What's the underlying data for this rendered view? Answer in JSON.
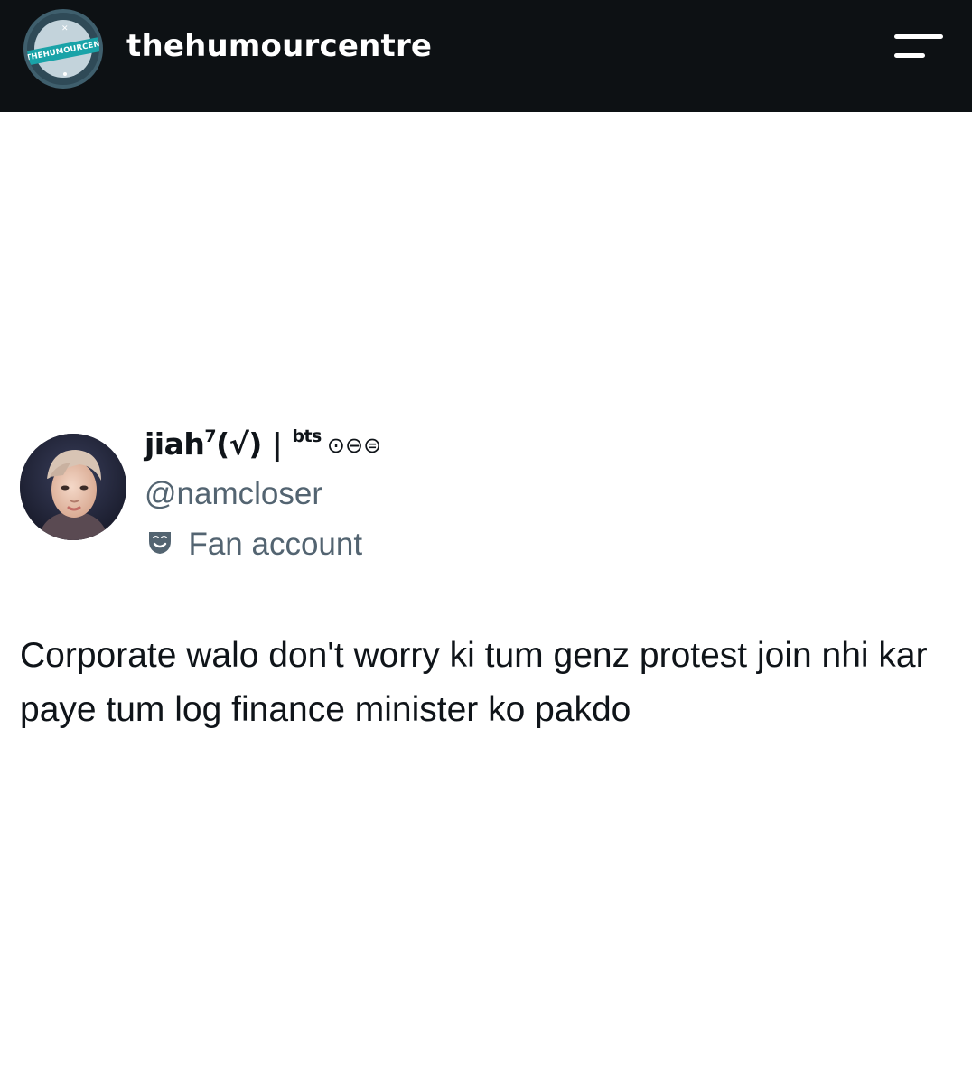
{
  "header": {
    "account_name": "thehumourcentre",
    "logo_text": "THEHUMOURCENTRE",
    "logo_icon": "humour-centre-logo-icon",
    "menu_icon": "hamburger-menu-icon"
  },
  "tweet": {
    "display_name": "jiah",
    "display_name_sup": "7",
    "display_name_rest": "(√) | ",
    "display_name_bts": "bts",
    "display_name_emojis": "⊙⊖⊜",
    "handle": "@namcloser",
    "badge_icon": "theater-mask-icon",
    "badge_label": "Fan account",
    "avatar_icon": "profile-avatar",
    "text": "Corporate walo don't worry ki tum genz protest join nhi kar paye tum log finance minister ko pakdo"
  },
  "colors": {
    "header_bg": "#0d1114",
    "text_primary": "#0f1419",
    "text_secondary": "#536471"
  }
}
